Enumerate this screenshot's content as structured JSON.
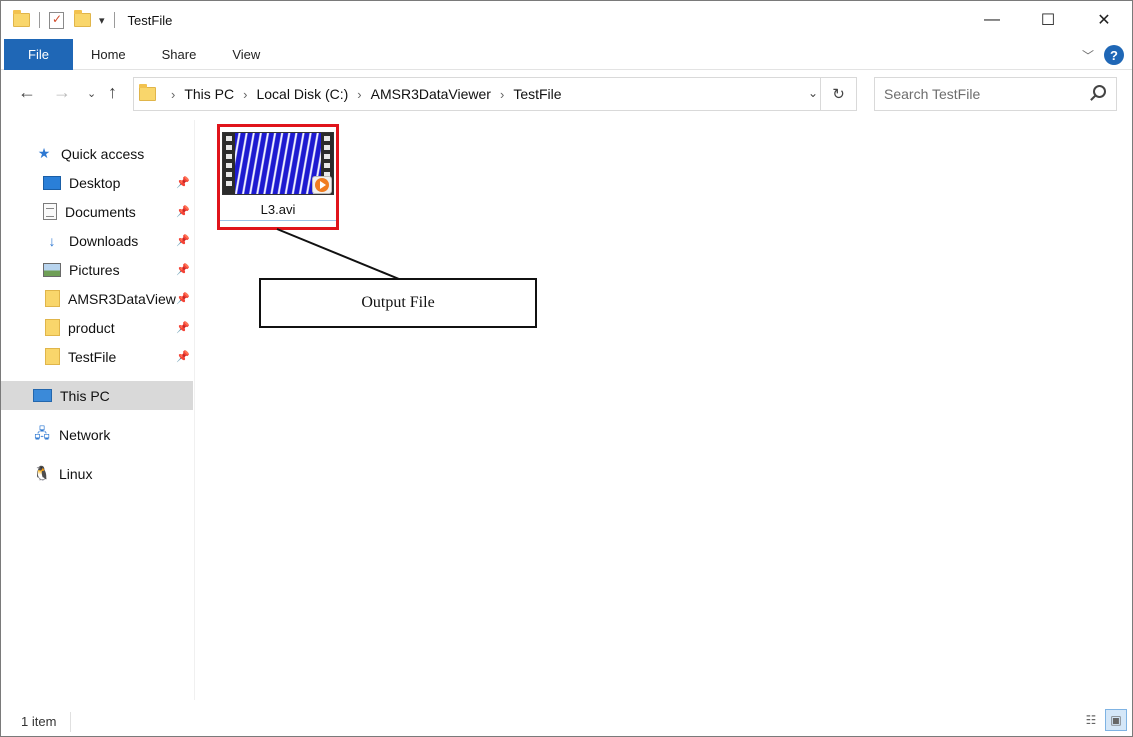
{
  "window": {
    "title": "TestFile",
    "controls": {
      "minimize": "—",
      "maximize": "☐",
      "close": "✕"
    }
  },
  "qat": {
    "dropdown": "▾"
  },
  "ribbon": {
    "tabs": [
      {
        "label": "File"
      },
      {
        "label": "Home"
      },
      {
        "label": "Share"
      },
      {
        "label": "View"
      }
    ],
    "help": "?"
  },
  "address": {
    "crumbs": [
      "This PC",
      "Local Disk (C:)",
      "AMSR3DataViewer",
      "TestFile"
    ]
  },
  "search": {
    "placeholder": "Search TestFile"
  },
  "nav_pane": {
    "quick_access": "Quick access",
    "pinned": [
      {
        "label": "Desktop",
        "icon": "desktop-icon"
      },
      {
        "label": "Documents",
        "icon": "documents-icon"
      },
      {
        "label": "Downloads",
        "icon": "downloads-icon"
      },
      {
        "label": "Pictures",
        "icon": "pictures-icon"
      },
      {
        "label": "AMSR3DataView",
        "icon": "folder-icon"
      },
      {
        "label": "product",
        "icon": "folder-icon"
      },
      {
        "label": "TestFile",
        "icon": "folder-icon"
      }
    ],
    "this_pc": "This PC",
    "network": "Network",
    "linux": "Linux"
  },
  "files": [
    {
      "name": "L3.avi",
      "icon": "video-file-icon"
    }
  ],
  "annotation": {
    "label": "Output File",
    "highlight_color": "#e0141b"
  },
  "status": {
    "item_count": "1 item"
  },
  "colors": {
    "accent": "#1f67b6",
    "selected_nav": "#d9d9d9"
  }
}
